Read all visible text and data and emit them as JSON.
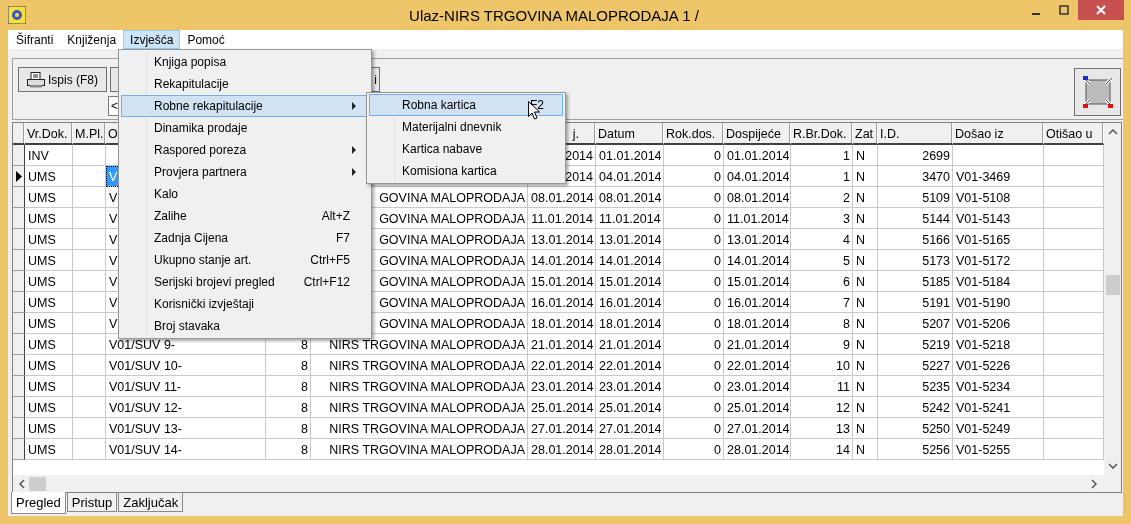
{
  "window": {
    "title": "Ulaz-NIRS TRGOVINA MALOPRODAJA 1 /"
  },
  "menu_bar": [
    {
      "label": "Šifranti",
      "selected": false
    },
    {
      "label": "Knjiženja",
      "selected": false
    },
    {
      "label": "Izvješća",
      "selected": true
    },
    {
      "label": "Pomoć",
      "selected": false
    }
  ],
  "toolbar": {
    "buttons": [
      {
        "label": "Ispis (F8)",
        "kind": "print"
      },
      {
        "label": "i",
        "kind": "plain"
      }
    ],
    "filter_field": {
      "value": "<"
    }
  },
  "menu": [
    {
      "label": "Knjiga popisa",
      "selected": false,
      "submenu": false
    },
    {
      "label": "Rekapitulacije",
      "selected": false,
      "submenu": false
    },
    {
      "label": "Robne rekapitulacije",
      "selected": true,
      "submenu": true
    },
    {
      "label": "Dinamika prodaje",
      "selected": false,
      "submenu": false
    },
    {
      "label": "Raspored poreza",
      "selected": false,
      "submenu": true
    },
    {
      "label": "Provjera partnera",
      "selected": false,
      "submenu": true
    },
    {
      "label": "Kalo",
      "selected": false,
      "submenu": false
    },
    {
      "label": "Zalihe",
      "shortcut": "Alt+Z",
      "selected": false,
      "submenu": false
    },
    {
      "label": "Zadnja Cijena",
      "shortcut": "F7",
      "selected": false,
      "submenu": false
    },
    {
      "label": "Ukupno stanje art.",
      "shortcut": "Ctrl+F5",
      "selected": false,
      "submenu": false
    },
    {
      "label": "Serijski brojevi pregled",
      "shortcut": "Ctrl+F12",
      "selected": false,
      "submenu": false
    },
    {
      "label": "Korisnički izvještaji",
      "selected": false,
      "submenu": false
    },
    {
      "label": "Broj stavaka",
      "selected": false,
      "submenu": false
    }
  ],
  "submenu": [
    {
      "label": "Robna kartica",
      "shortcut": "F2",
      "selected": true
    },
    {
      "label": "Materijalni dnevnik",
      "selected": false
    },
    {
      "label": "Kartica nabave",
      "selected": false
    },
    {
      "label": "Komisiona kartica",
      "selected": false
    }
  ],
  "table": {
    "columns": [
      "Vr.Dok.",
      "M.Pl.",
      "O",
      null,
      null,
      "j.",
      "Datum",
      "Rok.dos.",
      "Dospijeće",
      "R.Br.Dok.",
      "Zat",
      "I.D.",
      "Došao iz",
      "Otišao u"
    ],
    "rows": [
      {
        "selected": false,
        "cells": [
          "INV",
          null,
          null,
          null,
          null,
          "2014",
          "01.01.2014",
          "0",
          "01.01.2014",
          "1",
          "N",
          "2699",
          null,
          null
        ]
      },
      {
        "selected": true,
        "cells": [
          "UMS",
          null,
          "V",
          null,
          null,
          "2014",
          "04.01.2014",
          "0",
          "04.01.2014",
          "1",
          "N",
          "3470",
          "V01-3469",
          null
        ]
      },
      {
        "selected": false,
        "cells": [
          "UMS",
          null,
          "V",
          null,
          "GOVINA MALOPRODAJA",
          "08.01.2014",
          "08.01.2014",
          "0",
          "08.01.2014",
          "2",
          "N",
          "5109",
          "V01-5108",
          null
        ]
      },
      {
        "selected": false,
        "cells": [
          "UMS",
          null,
          "V",
          null,
          "GOVINA MALOPRODAJA",
          "11.01.2014",
          "11.01.2014",
          "0",
          "11.01.2014",
          "3",
          "N",
          "5144",
          "V01-5143",
          null
        ]
      },
      {
        "selected": false,
        "cells": [
          "UMS",
          null,
          "V",
          null,
          "GOVINA MALOPRODAJA",
          "13.01.2014",
          "13.01.2014",
          "0",
          "13.01.2014",
          "4",
          "N",
          "5166",
          "V01-5165",
          null
        ]
      },
      {
        "selected": false,
        "cells": [
          "UMS",
          null,
          "V",
          null,
          "GOVINA MALOPRODAJA",
          "14.01.2014",
          "14.01.2014",
          "0",
          "14.01.2014",
          "5",
          "N",
          "5173",
          "V01-5172",
          null
        ]
      },
      {
        "selected": false,
        "cells": [
          "UMS",
          null,
          "V",
          null,
          "GOVINA MALOPRODAJA",
          "15.01.2014",
          "15.01.2014",
          "0",
          "15.01.2014",
          "6",
          "N",
          "5185",
          "V01-5184",
          null
        ]
      },
      {
        "selected": false,
        "cells": [
          "UMS",
          null,
          "V",
          null,
          "GOVINA MALOPRODAJA",
          "16.01.2014",
          "16.01.2014",
          "0",
          "16.01.2014",
          "7",
          "N",
          "5191",
          "V01-5190",
          null
        ]
      },
      {
        "selected": false,
        "cells": [
          "UMS",
          null,
          "V",
          null,
          "GOVINA MALOPRODAJA",
          "18.01.2014",
          "18.01.2014",
          "0",
          "18.01.2014",
          "8",
          "N",
          "5207",
          "V01-5206",
          null
        ]
      },
      {
        "selected": false,
        "cells": [
          "UMS",
          null,
          "V01/SUV 9-",
          "8",
          "NIRS TRGOVINA MALOPRODAJA",
          "21.01.2014",
          "21.01.2014",
          "0",
          "21.01.2014",
          "9",
          "N",
          "5219",
          "V01-5218",
          null
        ]
      },
      {
        "selected": false,
        "cells": [
          "UMS",
          null,
          "V01/SUV 10-",
          "8",
          "NIRS TRGOVINA MALOPRODAJA",
          "22.01.2014",
          "22.01.2014",
          "0",
          "22.01.2014",
          "10",
          "N",
          "5227",
          "V01-5226",
          null
        ]
      },
      {
        "selected": false,
        "cells": [
          "UMS",
          null,
          "V01/SUV 11-",
          "8",
          "NIRS TRGOVINA MALOPRODAJA",
          "23.01.2014",
          "23.01.2014",
          "0",
          "23.01.2014",
          "11",
          "N",
          "5235",
          "V01-5234",
          null
        ]
      },
      {
        "selected": false,
        "cells": [
          "UMS",
          null,
          "V01/SUV 12-",
          "8",
          "NIRS TRGOVINA MALOPRODAJA",
          "25.01.2014",
          "25.01.2014",
          "0",
          "25.01.2014",
          "12",
          "N",
          "5242",
          "V01-5241",
          null
        ]
      },
      {
        "selected": false,
        "cells": [
          "UMS",
          null,
          "V01/SUV 13-",
          "8",
          "NIRS TRGOVINA MALOPRODAJA",
          "27.01.2014",
          "27.01.2014",
          "0",
          "27.01.2014",
          "13",
          "N",
          "5250",
          "V01-5249",
          null
        ]
      },
      {
        "selected": false,
        "cells": [
          "UMS",
          null,
          "V01/SUV 14-",
          "8",
          "NIRS TRGOVINA MALOPRODAJA",
          "28.01.2014",
          "28.01.2014",
          "0",
          "28.01.2014",
          "14",
          "N",
          "5256",
          "V01-5255",
          null
        ]
      }
    ]
  },
  "tabs": [
    {
      "label": "Pregled",
      "selected": true
    },
    {
      "label": "Pristup",
      "selected": false
    },
    {
      "label": "Zaključak",
      "selected": false
    }
  ]
}
